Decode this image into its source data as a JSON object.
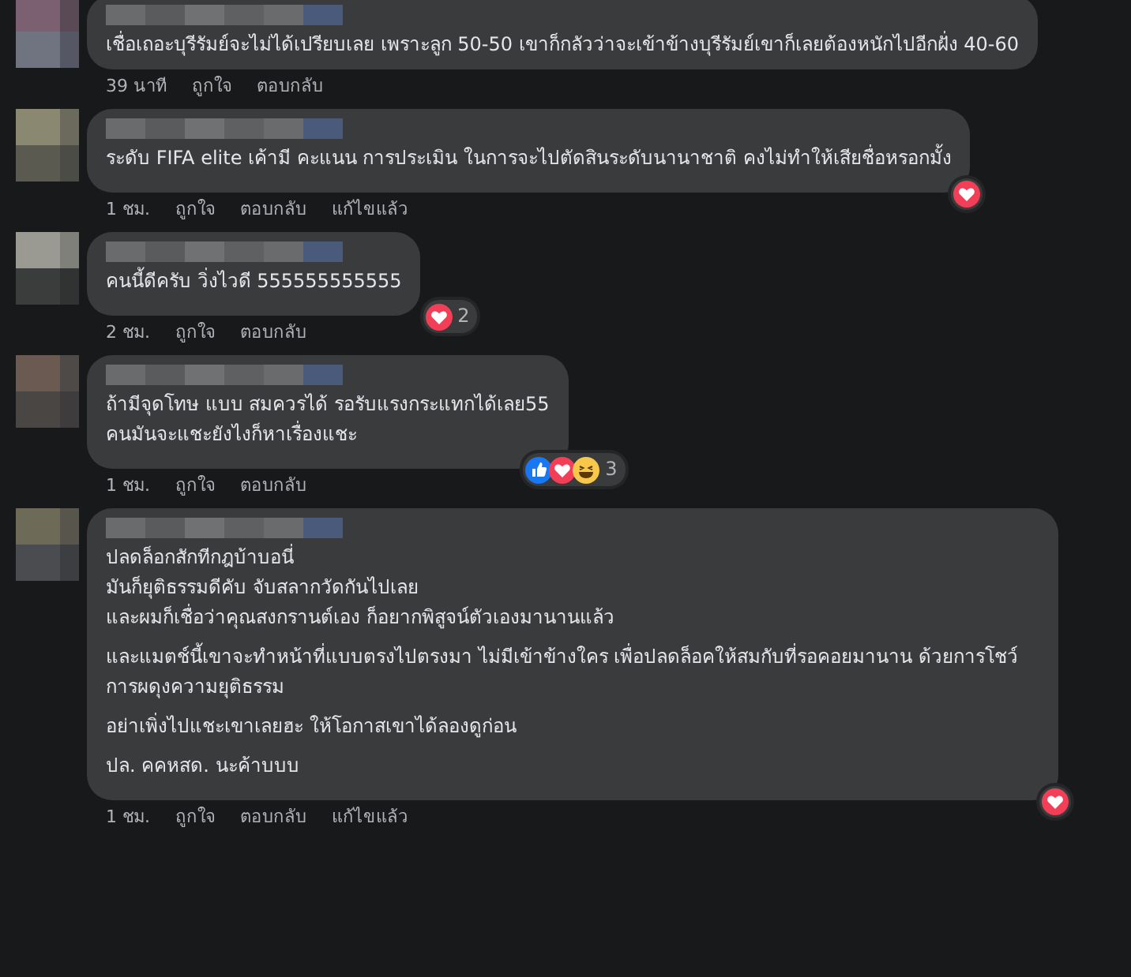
{
  "comments": [
    {
      "paragraphs": [
        "เชื่อเถอะบุรีรัมย์จะไม่ได้เปรียบเลย เพราะลูก 50-50 เขาก็กลัวว่าจะเข้าข้างบุรีรัมย์เขาก็เลยต้องหนักไปอีกฝั่ง 40-60"
      ],
      "time": "39 นาที",
      "like": "ถูกใจ",
      "reply": "ตอบกลับ"
    },
    {
      "paragraphs": [
        "ระดับ FIFA elite เค้ามี คะแนน การประเมิน ในการจะไปตัดสินระดับนานาชาติ คงไม่ทำให้เสียชื่อหรอกมั้ง"
      ],
      "time": "1 ชม.",
      "like": "ถูกใจ",
      "reply": "ตอบกลับ",
      "edited": "แก้ไขแล้ว",
      "reactions": {
        "items": [
          {
            "kind": "love"
          }
        ]
      }
    },
    {
      "paragraphs": [
        "คนนี้ดีครับ วิ่งไวดี 555555555555"
      ],
      "time": "2 ชม.",
      "like": "ถูกใจ",
      "reply": "ตอบกลับ",
      "reactions": {
        "items": [
          {
            "kind": "love"
          }
        ],
        "count": "2"
      }
    },
    {
      "paragraphs": [
        "ถ้ามีจุดโทษ แบบ สมควรได้ รอรับแรงกระแทกได้เลย55\nคนมันจะแชะยังไงก็หาเรื่องแชะ"
      ],
      "time": "1 ชม.",
      "like": "ถูกใจ",
      "reply": "ตอบกลับ",
      "reactions": {
        "items": [
          {
            "kind": "like"
          },
          {
            "kind": "love"
          },
          {
            "kind": "haha"
          }
        ],
        "count": "3"
      }
    },
    {
      "paragraphs": [
        "ปลดล็อกสักทีกฎบ้าบอนี่\nมันก็ยุติธรรมดีคับ จับสลากวัดกันไปเลย\nและผมก็เชื่อว่าคุณสงกรานต์เอง ก็อยากพิสูจน์ตัวเองมานานแล้ว",
        "และแมตช์นี้เขาจะทำหน้าที่แบบตรงไปตรงมา ไม่มีเข้าข้างใคร เพื่อปลดล็อคให้สมกับที่รอคอยมานาน ด้วยการโชว์การผดุงความยุติธรรม",
        "อย่าเพิ่งไปแชะเขาเลยฮะ ให้โอกาสเขาได้ลองดูก่อน",
        "ปล. คคหสด. นะค้าบบบ"
      ],
      "time": "1 ชม.",
      "like": "ถูกใจ",
      "reply": "ตอบกลับ",
      "edited": "แก้ไขแล้ว",
      "reactions": {
        "items": [
          {
            "kind": "love"
          }
        ]
      }
    }
  ]
}
